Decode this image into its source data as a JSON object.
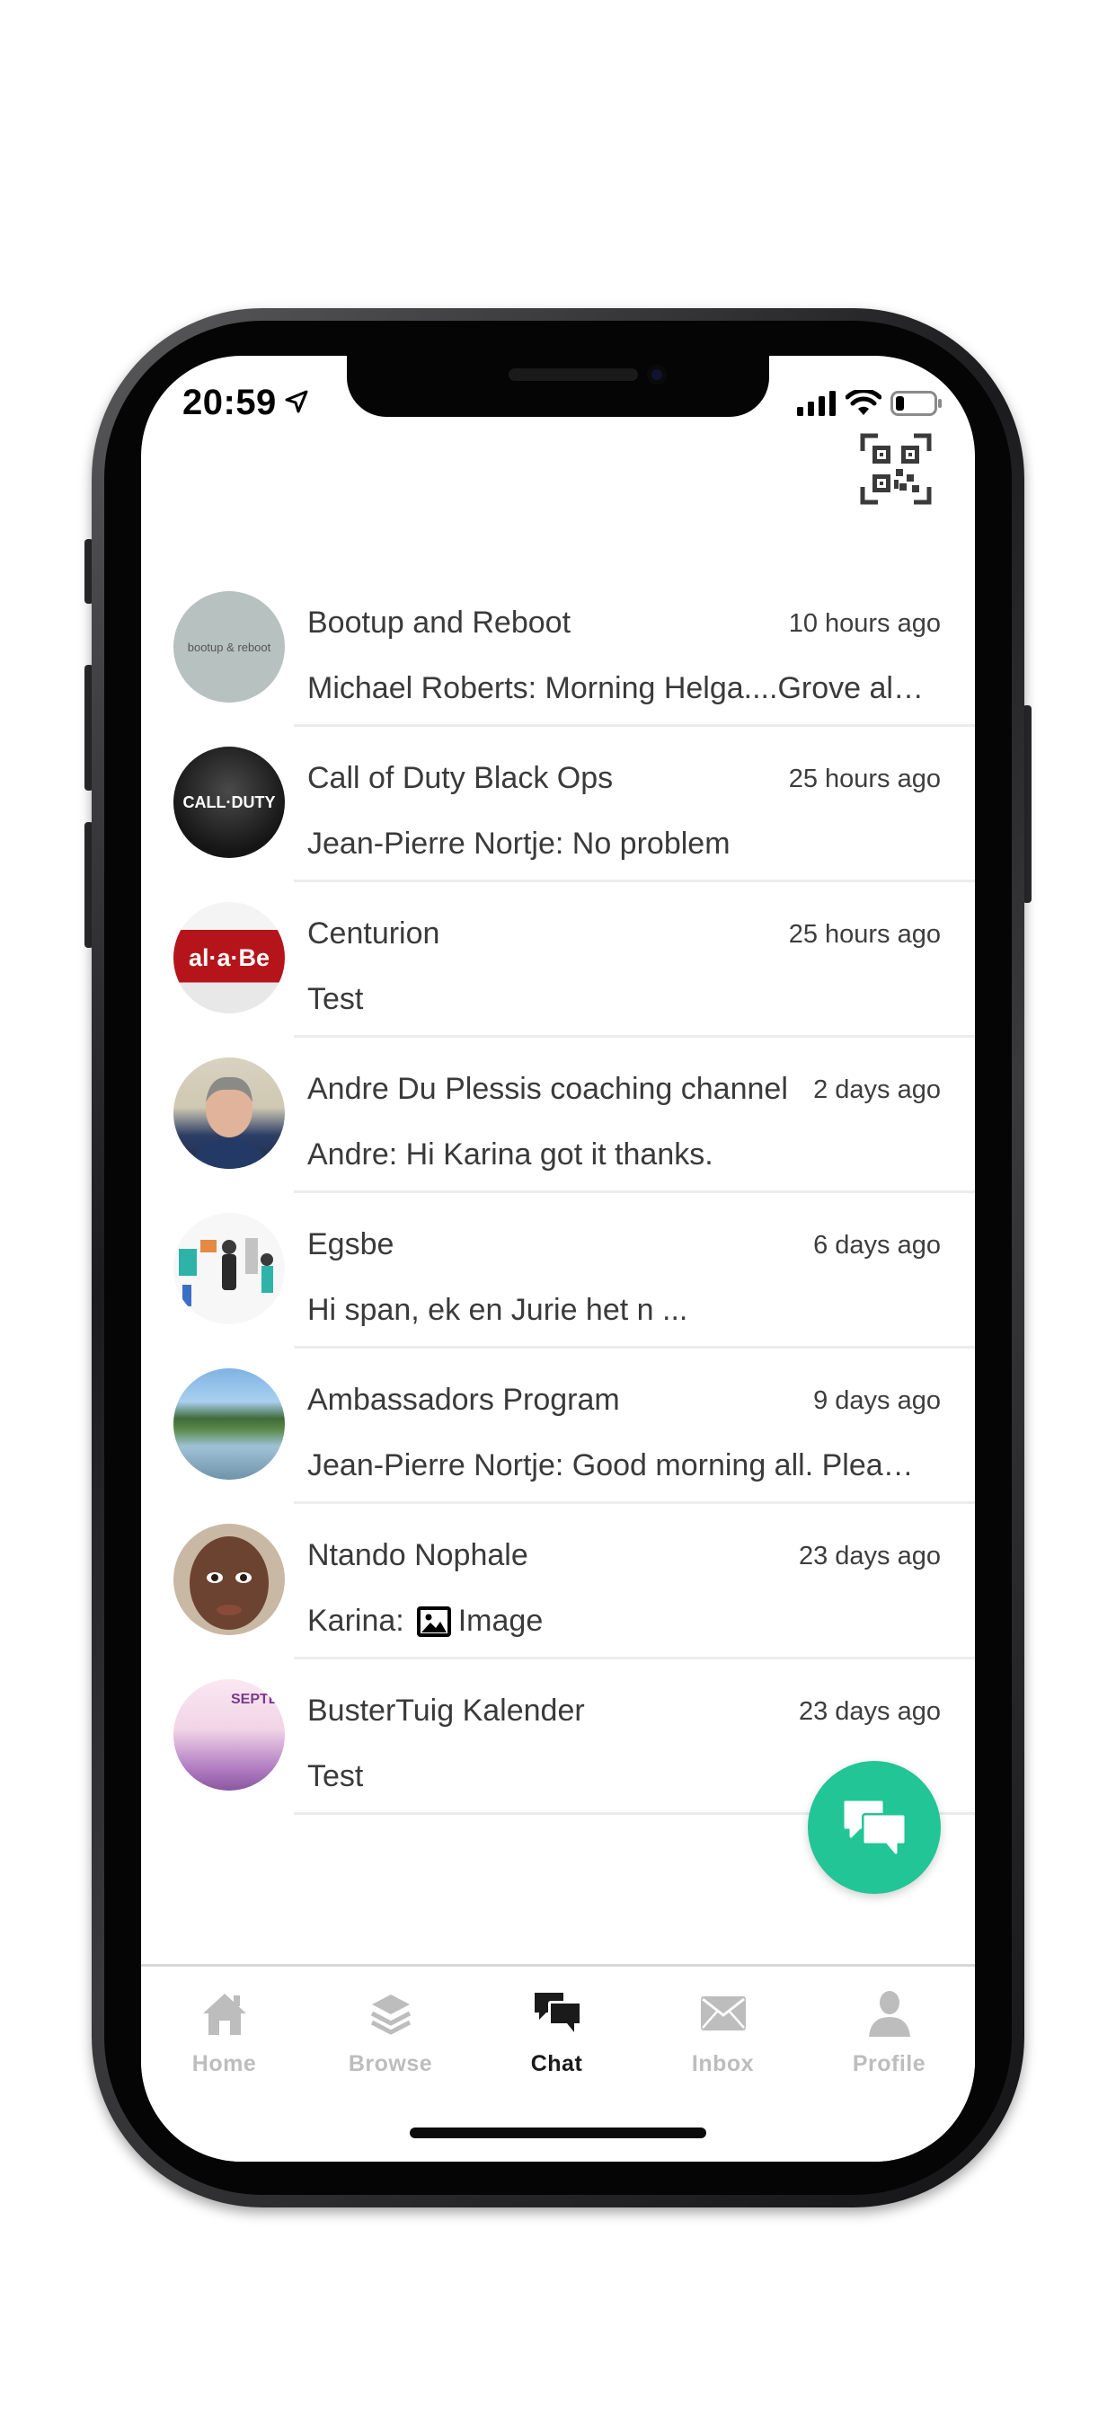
{
  "status_bar": {
    "time": "20:59"
  },
  "colors": {
    "accent": "#21c596",
    "tab_inactive": "#bdbdbd",
    "tab_active": "#1a1a1a"
  },
  "chats": [
    {
      "name": "Bootup and Reboot",
      "time": "10 hours ago",
      "preview": "Michael Roberts: Morning Helga....Grove al…",
      "avatar_text": "bootup & reboot"
    },
    {
      "name": "Call of Duty Black Ops",
      "time": "25 hours ago",
      "preview": "Jean-Pierre Nortje: No problem",
      "avatar_text": "CALL·DUTY"
    },
    {
      "name": "Centurion",
      "time": "25 hours ago",
      "preview": "Test",
      "avatar_text": "al·a·Be"
    },
    {
      "name": "Andre Du Plessis coaching channel",
      "time": "2 days ago",
      "preview": "Andre: Hi Karina got it thanks."
    },
    {
      "name": "Egsbe",
      "time": "6 days ago",
      "preview": "Hi span, ek en Jurie het n ..."
    },
    {
      "name": "Ambassadors Program",
      "time": "9 days ago",
      "preview": "Jean-Pierre Nortje: Good morning all. Plea…"
    },
    {
      "name": "Ntando Nophale",
      "time": "23 days ago",
      "preview_prefix": "Karina:",
      "preview_suffix": "Image",
      "preview_icon": "image-icon"
    },
    {
      "name": "BusterTuig Kalender",
      "time": "23 days ago",
      "preview": "Test",
      "avatar_text": "SEPTE"
    }
  ],
  "tabs": [
    {
      "label": "Home",
      "icon": "home-icon"
    },
    {
      "label": "Browse",
      "icon": "layers-icon"
    },
    {
      "label": "Chat",
      "icon": "chat-icon",
      "active": true
    },
    {
      "label": "Inbox",
      "icon": "mail-icon"
    },
    {
      "label": "Profile",
      "icon": "person-icon"
    }
  ]
}
